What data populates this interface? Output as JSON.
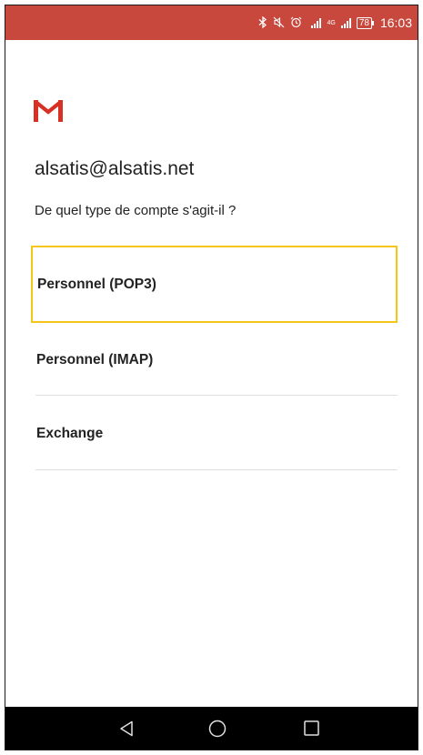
{
  "status_bar": {
    "network_label": "4G",
    "battery": "78",
    "time": "16:03",
    "icons": [
      "bluetooth-icon",
      "mute-icon",
      "alarm-icon",
      "signal-icon",
      "battery-icon"
    ],
    "background_color": "#c9483d"
  },
  "app": {
    "logo": "gmail-icon",
    "account_email": "alsatis@alsatis.net",
    "question": "De quel type de compte s'agit-il ?"
  },
  "options": [
    {
      "label": "Personnel (POP3)",
      "highlighted": true
    },
    {
      "label": "Personnel (IMAP)",
      "highlighted": false
    },
    {
      "label": "Exchange",
      "highlighted": false
    }
  ],
  "highlight_color": "#f5c518",
  "nav_bar": {
    "buttons": [
      "back-icon",
      "home-icon",
      "recents-icon"
    ]
  }
}
